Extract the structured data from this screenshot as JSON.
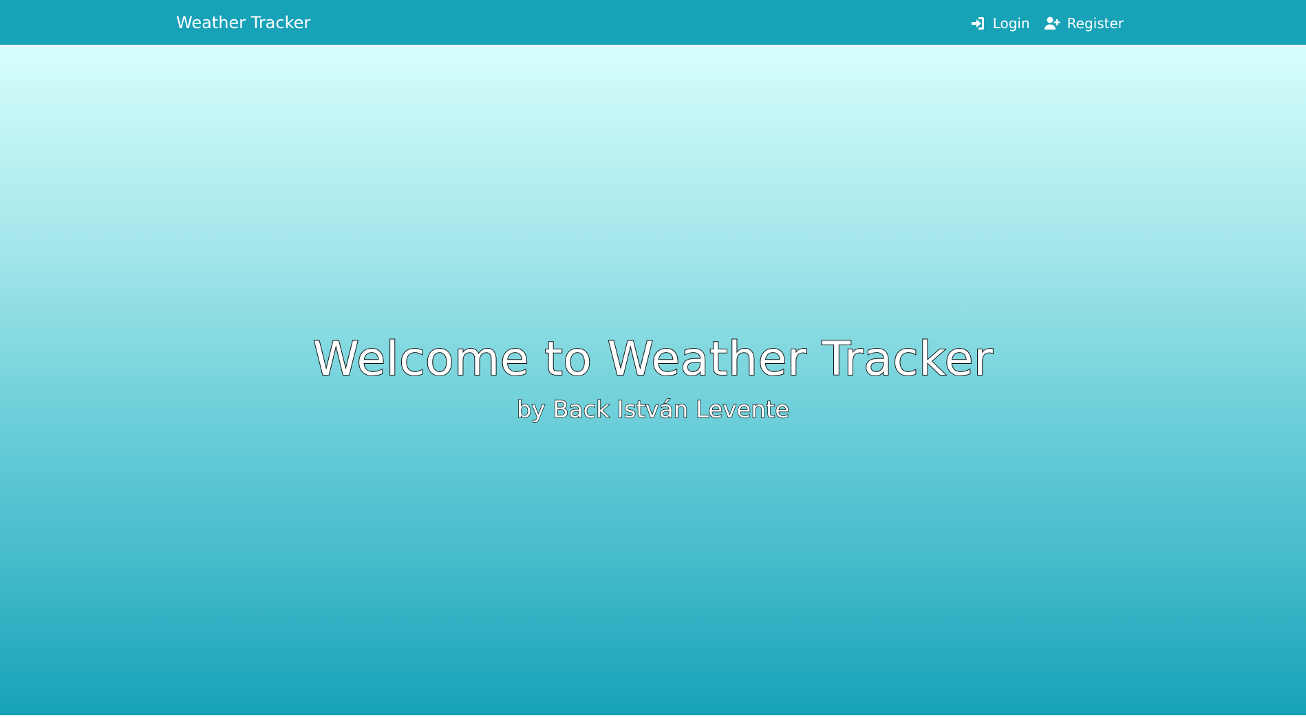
{
  "navbar": {
    "brand": "Weather Tracker",
    "links": [
      {
        "label": "Login",
        "icon": "sign-in-icon"
      },
      {
        "label": "Register",
        "icon": "user-plus-icon"
      }
    ]
  },
  "hero": {
    "title": "Welcome to Weather Tracker",
    "subtitle": "by Back István Levente"
  },
  "colors": {
    "navbar_bg": "#17a2b8",
    "hero_top": "#d6fefc",
    "hero_bottom": "#17a2b8",
    "text": "#ffffff"
  }
}
